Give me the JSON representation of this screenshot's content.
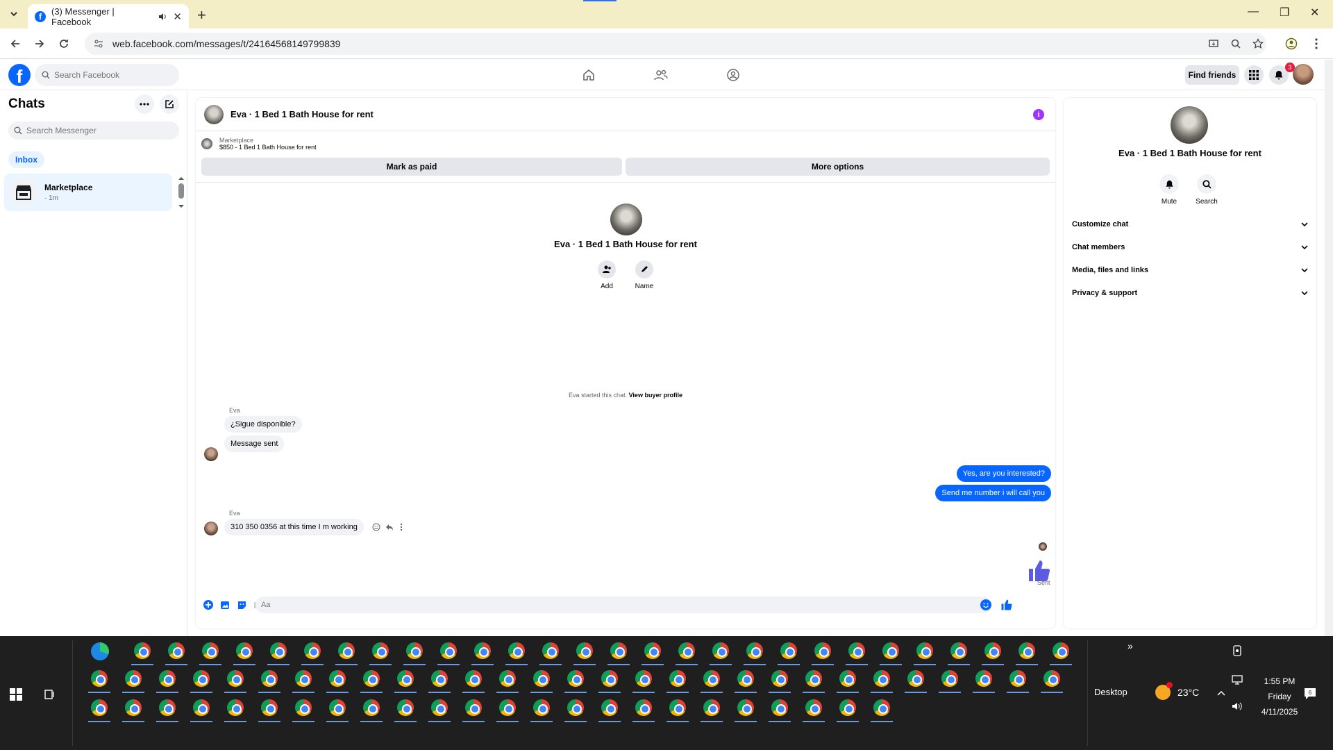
{
  "browser": {
    "tab_title": "(3) Messenger | Facebook",
    "url": "web.facebook.com/messages/t/24164568149799839"
  },
  "fb": {
    "search_placeholder": "Search Facebook",
    "find_friends": "Find friends",
    "notifications_count": "3"
  },
  "sidebar": {
    "title": "Chats",
    "search_placeholder": "Search Messenger",
    "filter": "Inbox",
    "conversations": [
      {
        "name": "Marketplace",
        "time": "· 1m"
      }
    ]
  },
  "conversation": {
    "title": "Eva · 1 Bed 1 Bath House for rent",
    "marketplace_label": "Marketplace",
    "listing": "$850 - 1 Bed 1 Bath House for rent",
    "mark_paid": "Mark as paid",
    "more_options": "More options",
    "add_label": "Add",
    "name_label": "Name",
    "started_text": "Eva started this chat.",
    "view_profile": "View buyer profile",
    "messages": [
      {
        "sender": "Eva",
        "text": "¿Sigue disponible?"
      },
      {
        "text": "Message sent"
      },
      {
        "text": "Yes, are you interested?"
      },
      {
        "text": "Send me number i will call you"
      },
      {
        "sender": "Eva",
        "text": "310 350 0356 at this time I m working"
      }
    ],
    "sent_label": "Sent",
    "composer_placeholder": "Aa"
  },
  "info_panel": {
    "name": "Eva · 1 Bed 1 Bath House for rent",
    "mute": "Mute",
    "search": "Search",
    "sections": [
      "Customize chat",
      "Chat members",
      "Media, files and links",
      "Privacy & support"
    ]
  },
  "taskbar": {
    "desktop": "Desktop",
    "temperature": "23°C",
    "time": "1:55 PM",
    "day": "Friday",
    "date": "4/11/2025",
    "notification_count": "6"
  },
  "colors": {
    "accent": "#0866ff",
    "info_icon": "#a033ff",
    "like": "#5b5ce2"
  }
}
